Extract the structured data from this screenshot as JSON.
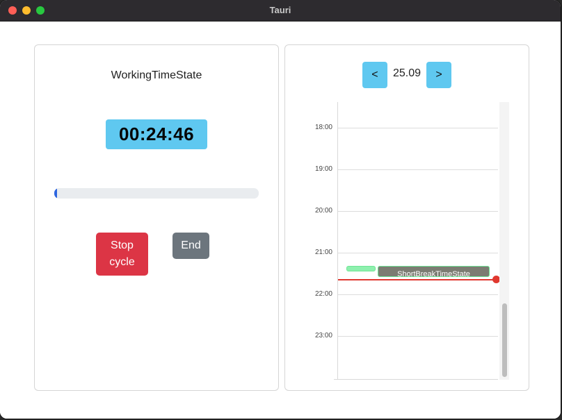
{
  "window": {
    "title": "Tauri"
  },
  "timer_panel": {
    "state_name": "WorkingTimeState",
    "timer": "00:24:46",
    "progress_fraction": 0.01,
    "stop_label": "Stop cycle",
    "end_label": "End"
  },
  "calendar_panel": {
    "prev_label": "<",
    "date": "25.09",
    "next_label": ">",
    "hours": [
      "18:00",
      "19:00",
      "20:00",
      "21:00",
      "22:00",
      "23:00"
    ],
    "events": [
      {
        "label": "",
        "color": "#8ef0ae"
      },
      {
        "label": "ShortBreakTimeState",
        "color": "#7b7c72"
      }
    ],
    "now_line_color": "#e0382f"
  },
  "colors": {
    "accent": "#5fc8f0",
    "danger": "#dc3545",
    "secondary": "#6c757d",
    "progress": "#2e66e0"
  }
}
